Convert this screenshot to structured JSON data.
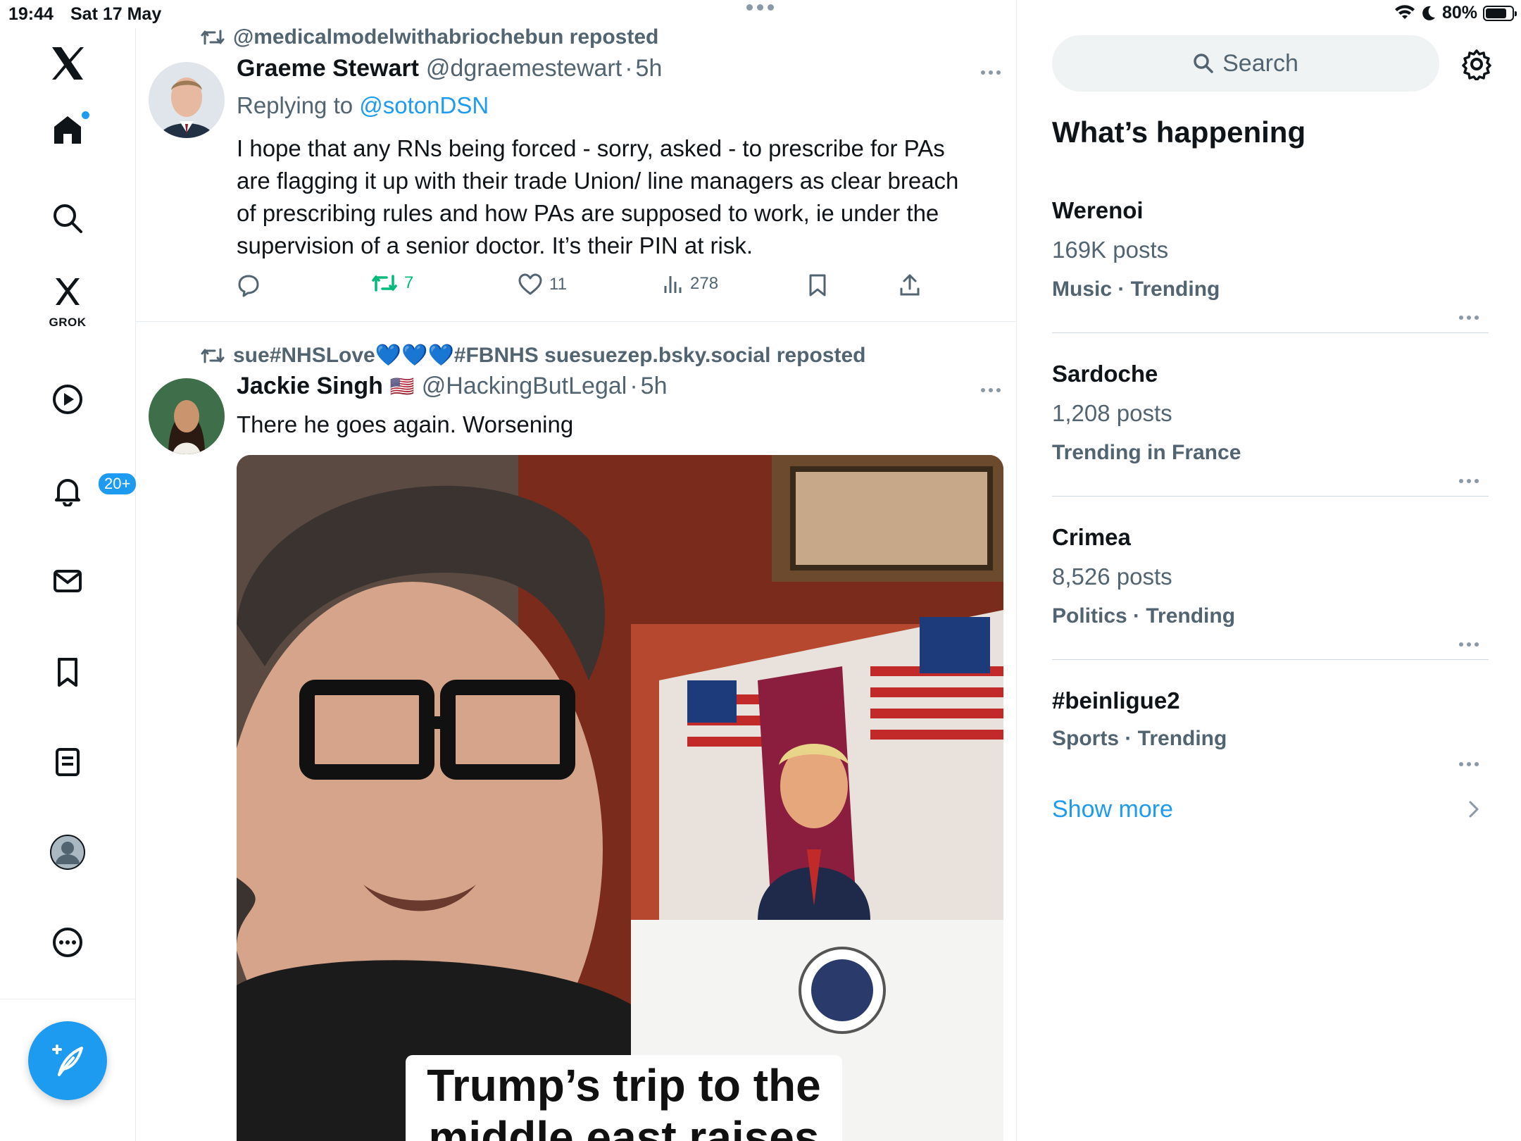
{
  "status_bar": {
    "time": "19:44",
    "date": "Sat 17 May",
    "battery": "80%",
    "battery_level": 0.8
  },
  "sidebar": {
    "grok_label": "GROK",
    "notifications_badge": "20+"
  },
  "feed": {
    "tweets": [
      {
        "repost_by": "@medicalmodelwithabriochebun reposted",
        "name": "Graeme Stewart",
        "handle": "@dgraemestewart",
        "sep": "·",
        "time": "5h",
        "reply_prefix": "Replying to",
        "reply_to": "@sotonDSN",
        "text": "I hope that any RNs being forced - sorry, asked - to prescribe for PAs are flagging it up with their trade Union/ line managers as clear breach of prescribing rules and how PAs are supposed to work, ie under the supervision of a senior doctor. It’s their PIN at risk.",
        "reposts": "7",
        "likes": "11",
        "views": "278"
      },
      {
        "repost_by": "sue#NHSLove💙💙💙#FBNHS suesuezep.bsky.social reposted",
        "name": "Jackie Singh",
        "flag": "🇺🇸",
        "handle": "@HackingButLegal",
        "sep": "·",
        "time": "5h",
        "text": "There he goes again. Worsening",
        "media_caption": "Trump’s trip to the middle east raises"
      }
    ]
  },
  "right_panel": {
    "search_placeholder": "Search",
    "section_title": "What’s happening",
    "trends": [
      {
        "name": "Werenoi",
        "posts": "169K posts",
        "category": "Music · Trending"
      },
      {
        "name": "Sardoche",
        "posts": "1,208 posts",
        "category": "Trending in France"
      },
      {
        "name": "Crimea",
        "posts": "8,526 posts",
        "category": "Politics · Trending"
      },
      {
        "name": "#beinligue2",
        "posts": "",
        "category": "Sports · Trending"
      }
    ],
    "show_more": "Show more"
  },
  "colors": {
    "accent": "#1d9bf0",
    "repost_green": "#00ba7c",
    "secondary_text": "#536471",
    "primary_text": "#0f1419"
  }
}
